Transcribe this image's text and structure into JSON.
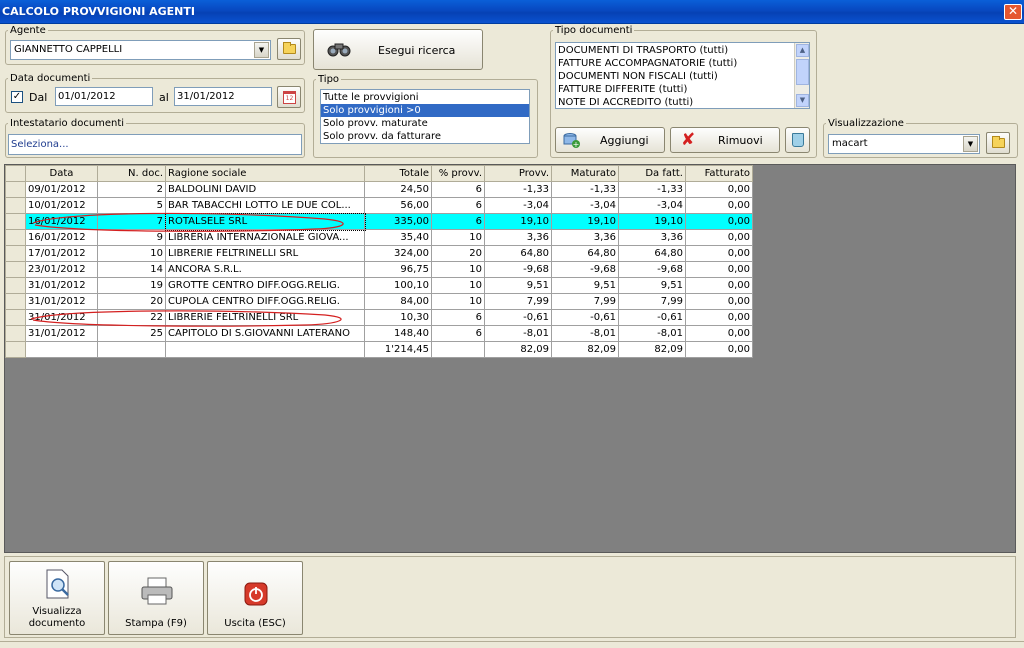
{
  "window": {
    "title": "CALCOLO PROVVIGIONI AGENTI",
    "close": "✕"
  },
  "agente": {
    "legend": "Agente",
    "value": "GIANNETTO CAPPELLI"
  },
  "search_button": {
    "label": "Esegui ricerca"
  },
  "data_documenti": {
    "legend": "Data documenti",
    "checkbox_label": "Dal",
    "from": "01/01/2012",
    "to_label": "al",
    "to": "31/01/2012",
    "calendar": "12"
  },
  "intestatario": {
    "legend": "Intestatario documenti",
    "value": "Seleziona..."
  },
  "tipo": {
    "legend": "Tipo",
    "options": [
      "Tutte le provvigioni",
      "Solo provvigioni >0",
      "Solo provv. maturate",
      "Solo provv. da fatturare"
    ]
  },
  "tipo_documenti": {
    "legend": "Tipo documenti",
    "items": [
      "DOCUMENTI DI TRASPORTO (tutti)",
      "FATTURE ACCOMPAGNATORIE (tutti)",
      "DOCUMENTI NON FISCALI (tutti)",
      "FATTURE DIFFERITE (tutti)",
      "NOTE DI ACCREDITO (tutti)"
    ]
  },
  "buttons": {
    "aggiungi": "Aggiungi",
    "rimuovi": "Rimuovi"
  },
  "visualizzazione": {
    "legend": "Visualizzazione",
    "value": "macart"
  },
  "grid": {
    "headers": [
      "Data",
      "N. doc.",
      "Ragione sociale",
      "Totale",
      "% provv.",
      "Provv.",
      "Maturato",
      "Da fatt.",
      "Fatturato"
    ],
    "rows": [
      [
        "09/01/2012",
        "2",
        "BALDOLINI DAVID",
        "24,50",
        "6",
        "-1,33",
        "-1,33",
        "-1,33",
        "0,00"
      ],
      [
        "10/01/2012",
        "5",
        "BAR TABACCHI LOTTO LE DUE COL...",
        "56,00",
        "6",
        "-3,04",
        "-3,04",
        "-3,04",
        "0,00"
      ],
      [
        "16/01/2012",
        "7",
        "ROTALSELE SRL",
        "335,00",
        "6",
        "19,10",
        "19,10",
        "19,10",
        "0,00"
      ],
      [
        "16/01/2012",
        "9",
        "LIBRERIA INTERNAZIONALE GIOVA...",
        "35,40",
        "10",
        "3,36",
        "3,36",
        "3,36",
        "0,00"
      ],
      [
        "17/01/2012",
        "10",
        "LIBRERIE FELTRINELLI SRL",
        "324,00",
        "20",
        "64,80",
        "64,80",
        "64,80",
        "0,00"
      ],
      [
        "23/01/2012",
        "14",
        "ANCORA S.R.L.",
        "96,75",
        "10",
        "-9,68",
        "-9,68",
        "-9,68",
        "0,00"
      ],
      [
        "31/01/2012",
        "19",
        "GROTTE CENTRO DIFF.OGG.RELIG.",
        "100,10",
        "10",
        "9,51",
        "9,51",
        "9,51",
        "0,00"
      ],
      [
        "31/01/2012",
        "20",
        "CUPOLA CENTRO DIFF.OGG.RELIG.",
        "84,00",
        "10",
        "7,99",
        "7,99",
        "7,99",
        "0,00"
      ],
      [
        "31/01/2012",
        "22",
        "LIBRERIE FELTRINELLI SRL",
        "10,30",
        "6",
        "-0,61",
        "-0,61",
        "-0,61",
        "0,00"
      ],
      [
        "31/01/2012",
        "25",
        "CAPITOLO DI S.GIOVANNI LATERANO",
        "148,40",
        "6",
        "-8,01",
        "-8,01",
        "-8,01",
        "0,00"
      ]
    ],
    "totals": [
      "",
      "",
      "",
      "1'214,45",
      "",
      "82,09",
      "82,09",
      "82,09",
      "0,00"
    ]
  },
  "bottom": {
    "visualizza": "Visualizza documento",
    "stampa": "Stampa (F9)",
    "uscita": "Uscita (ESC)"
  }
}
